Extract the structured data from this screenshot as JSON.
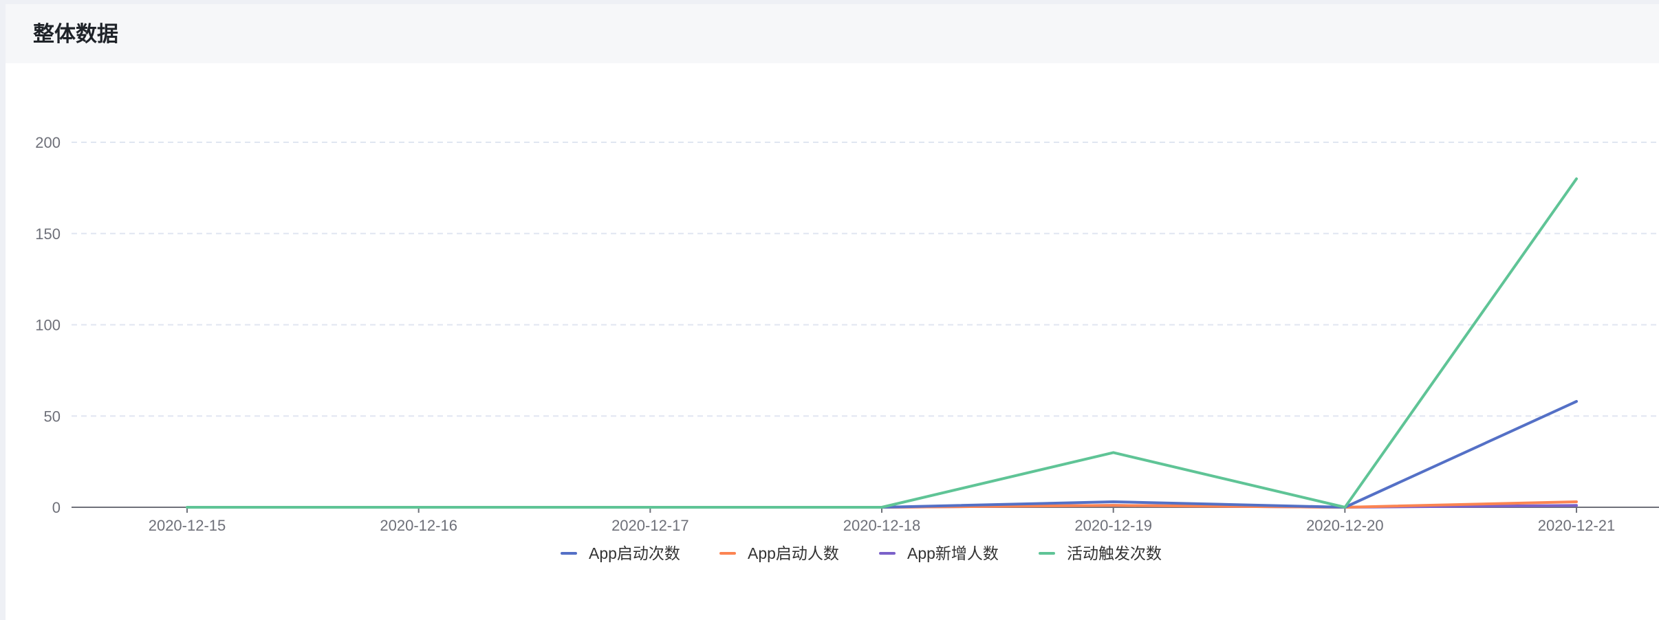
{
  "panel": {
    "title": "整体数据"
  },
  "chart_data": {
    "type": "line",
    "title": "",
    "xlabel": "",
    "ylabel": "",
    "categories": [
      "2020-12-15",
      "2020-12-16",
      "2020-12-17",
      "2020-12-18",
      "2020-12-19",
      "2020-12-20",
      "2020-12-21"
    ],
    "ylim": [
      0,
      200
    ],
    "yticks": [
      0,
      50,
      100,
      150,
      200
    ],
    "grid": true,
    "legend_position": "bottom-center",
    "series": [
      {
        "name": "App启动次数",
        "color": "#5470c6",
        "values": [
          null,
          null,
          null,
          0,
          3,
          0,
          58
        ]
      },
      {
        "name": "App启动人数",
        "color": "#fc8452",
        "values": [
          null,
          null,
          null,
          0,
          1,
          0,
          3
        ]
      },
      {
        "name": "App新增人数",
        "color": "#7b61c9",
        "values": [
          null,
          null,
          null,
          0,
          1,
          0,
          1
        ]
      },
      {
        "name": "活动触发次数",
        "color": "#5fc496",
        "values": [
          0,
          0,
          0,
          0,
          30,
          0,
          180
        ]
      }
    ]
  }
}
